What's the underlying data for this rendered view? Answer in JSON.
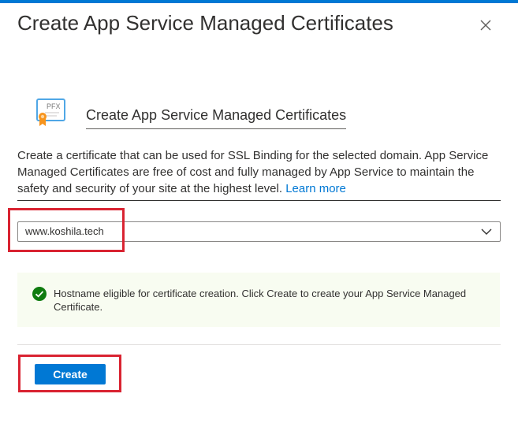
{
  "panel": {
    "title": "Create App Service Managed Certificates",
    "close_icon": "close-icon"
  },
  "section": {
    "icon": "pfx-certificate-icon",
    "icon_label": "PFX",
    "title": "Create App Service Managed Certificates",
    "description": "Create a certificate that can be used for SSL Binding for the selected domain. App Service Managed Certificates are free of cost and fully managed by App Service to maintain the safety and security of your site at the highest level.",
    "learn_more": "Learn more"
  },
  "domain_select": {
    "value": "www.koshila.tech",
    "chevron_icon": "chevron-down-icon"
  },
  "info_bar": {
    "icon": "success-check-icon",
    "text": "Hostname eligible for certificate creation. Click Create to create your App Service Managed Certificate."
  },
  "actions": {
    "create_label": "Create"
  },
  "colors": {
    "accent": "#0078d4",
    "annotation_red": "#d92331",
    "success_green": "#107c10",
    "success_background": "#f8fcf1"
  }
}
